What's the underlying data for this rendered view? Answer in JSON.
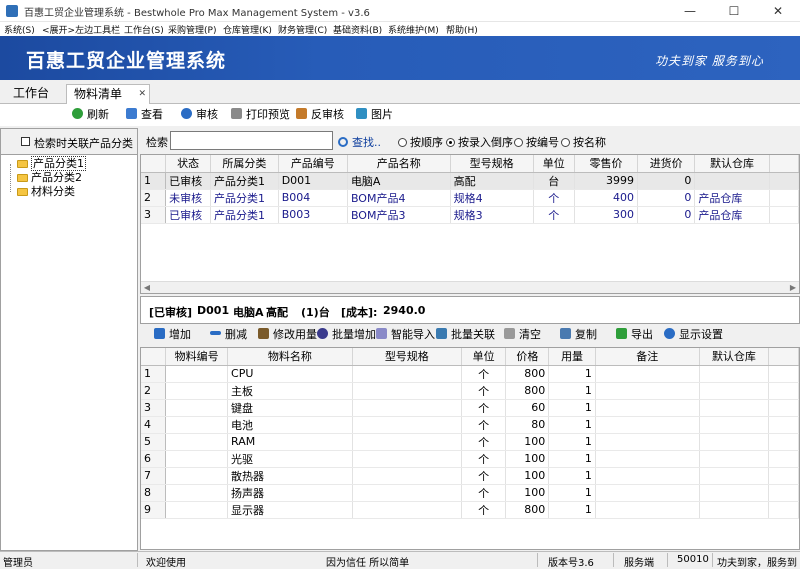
{
  "window": {
    "title": "百惠工贸企业管理系统 - Bestwhole Pro Max Management System - v3.6",
    "minimize": "—",
    "maximize": "☐",
    "close": "✕"
  },
  "menu": [
    "系统(S)",
    "<展开>左边工具栏",
    "工作台(S)",
    "采购管理(P)",
    "仓库管理(K)",
    "财务管理(C)",
    "基础资料(B)",
    "系统维护(M)",
    "帮助(H)"
  ],
  "banner": {
    "title": "百惠工贸企业管理系统",
    "slogan": "功夫到家  服务到心"
  },
  "tabs": [
    {
      "label": "工作台",
      "close": ""
    },
    {
      "label": "物料清单",
      "close": "✕"
    }
  ],
  "toolbar": [
    {
      "label": "刷新",
      "icon": "refresh-icon",
      "color": "#2e9e3a"
    },
    {
      "label": "查看",
      "icon": "view-icon",
      "color": "#3c7bd0"
    },
    {
      "label": "审核",
      "icon": "approve-icon",
      "color": "#2a6cc4"
    },
    {
      "label": "打印预览",
      "icon": "print-icon",
      "color": "#707070"
    },
    {
      "label": "反审核",
      "icon": "unapprove-icon",
      "color": "#c47a2a"
    },
    {
      "label": "图片",
      "icon": "image-icon",
      "color": "#2f8fc2"
    }
  ],
  "left_panel": {
    "checkbox_label": "检索时关联产品分类",
    "tree": [
      "产品分类1",
      "产品分类2",
      "材料分类"
    ]
  },
  "search": {
    "label": "检索",
    "value": "",
    "find_label": "查找..",
    "options": [
      "按顺序",
      "按录入倒序",
      "按编号",
      "按名称"
    ],
    "selected": "按录入倒序"
  },
  "products": {
    "columns": [
      "",
      "状态",
      "所属分类",
      "产品编号",
      "产品名称",
      "型号规格",
      "单位",
      "零售价",
      "进货价",
      "默认仓库"
    ],
    "rows": [
      [
        "1",
        "已审核",
        "产品分类1",
        "D001",
        "电脑A",
        "高配",
        "台",
        "3999",
        "0",
        ""
      ],
      [
        "2",
        "未审核",
        "产品分类1",
        "B004",
        "BOM产品4",
        "规格4",
        "个",
        "400",
        "0",
        "产品仓库"
      ],
      [
        "3",
        "已审核",
        "产品分类1",
        "B003",
        "BOM产品3",
        "规格3",
        "个",
        "300",
        "0",
        "产品仓库"
      ]
    ]
  },
  "summary": {
    "status": "[已审核]",
    "code": "D001",
    "name": "电脑A",
    "spec": "高配",
    "qty": "(1)台",
    "cost_label": "[成本]:",
    "cost": "2940.0"
  },
  "toolbar2": [
    {
      "label": "增加",
      "icon": "add-icon",
      "color": "#2a6cc4"
    },
    {
      "label": "删减",
      "icon": "remove-icon",
      "color": "#2a6cc4"
    },
    {
      "label": "修改用量",
      "icon": "edit-icon",
      "color": "#7a5a2a"
    },
    {
      "label": "批量增加",
      "icon": "batch-add-icon",
      "color": "#3a3a8c"
    },
    {
      "label": "智能导入",
      "icon": "import-icon",
      "color": "#6a6aaa"
    },
    {
      "label": "批量关联",
      "icon": "link-icon",
      "color": "#3a7ab0"
    },
    {
      "label": "清空",
      "icon": "trash-icon",
      "color": "#888888"
    },
    {
      "label": "复制",
      "icon": "copy-icon",
      "color": "#4a7ab0"
    },
    {
      "label": "导出",
      "icon": "export-icon",
      "color": "#2e9e3a"
    },
    {
      "label": "显示设置",
      "icon": "settings-icon",
      "color": "#2a6cc4"
    }
  ],
  "materials": {
    "columns": [
      "",
      "物料编号",
      "物料名称",
      "型号规格",
      "单位",
      "价格",
      "用量",
      "备注",
      "默认仓库"
    ],
    "rows": [
      [
        "1",
        "",
        "CPU",
        "",
        "个",
        "800",
        "1",
        "",
        ""
      ],
      [
        "2",
        "",
        "主板",
        "",
        "个",
        "800",
        "1",
        "",
        ""
      ],
      [
        "3",
        "",
        "键盘",
        "",
        "个",
        "60",
        "1",
        "",
        ""
      ],
      [
        "4",
        "",
        "电池",
        "",
        "个",
        "80",
        "1",
        "",
        ""
      ],
      [
        "5",
        "",
        "RAM",
        "",
        "个",
        "100",
        "1",
        "",
        ""
      ],
      [
        "6",
        "",
        "光驱",
        "",
        "个",
        "100",
        "1",
        "",
        ""
      ],
      [
        "7",
        "",
        "散热器",
        "",
        "个",
        "100",
        "1",
        "",
        ""
      ],
      [
        "8",
        "",
        "扬声器",
        "",
        "个",
        "100",
        "1",
        "",
        ""
      ],
      [
        "9",
        "",
        "显示器",
        "",
        "个",
        "800",
        "1",
        "",
        ""
      ]
    ]
  },
  "statusbar": [
    "管理员",
    "欢迎使用",
    "因为信任 所以简单",
    "版本号3.6",
    "服务端",
    "50010",
    "功夫到家，服务到"
  ]
}
